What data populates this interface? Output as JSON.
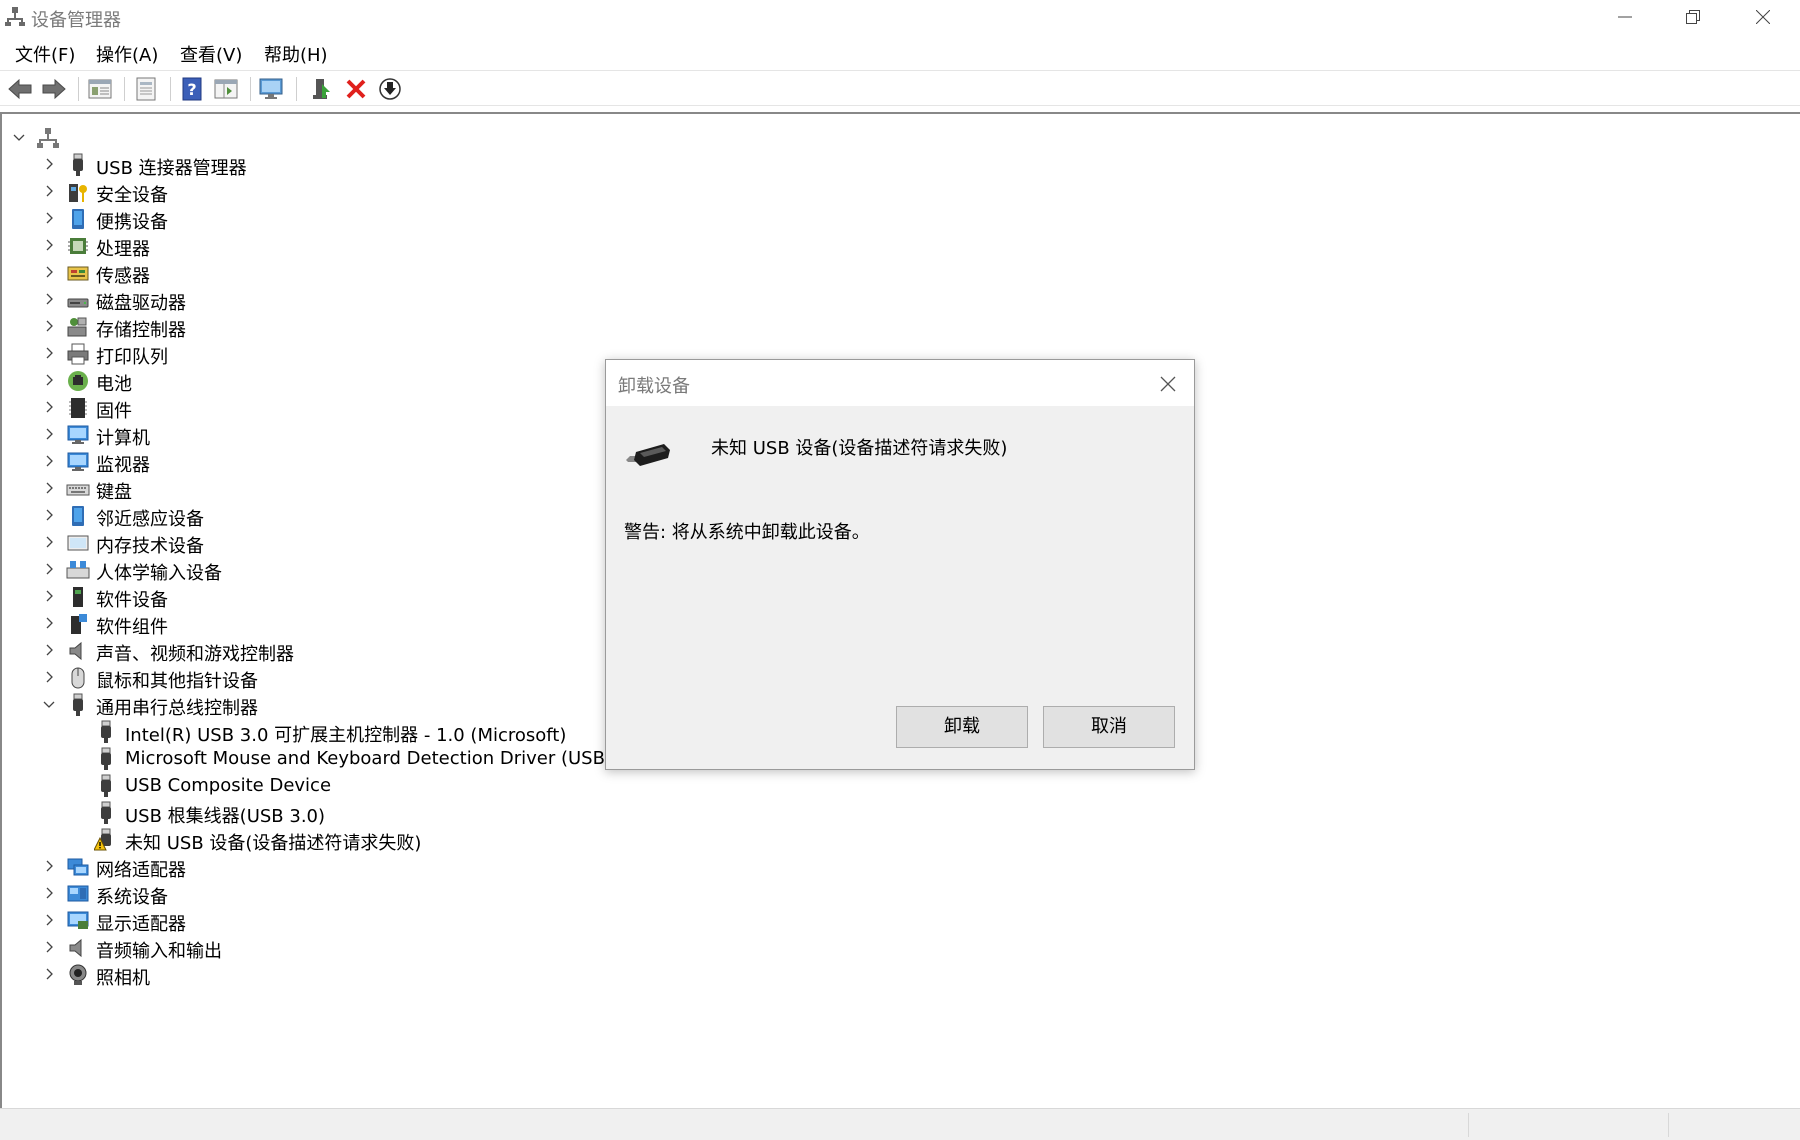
{
  "window": {
    "title": "设备管理器"
  },
  "menu": [
    {
      "label": "文件(F)"
    },
    {
      "label": "操作(A)"
    },
    {
      "label": "查看(V)"
    },
    {
      "label": "帮助(H)"
    }
  ],
  "toolbar": {
    "icons": [
      "back-icon",
      "forward-icon",
      "show-hide-tree-icon",
      "properties-icon",
      "help-icon",
      "view-icon",
      "scan-hardware-icon",
      "update-driver-icon",
      "uninstall-icon",
      "disable-icon"
    ]
  },
  "tree": {
    "root_icon": "computer-root-icon",
    "categories": [
      {
        "label": "USB 连接器管理器",
        "icon": "usb-plug-icon",
        "expanded": false
      },
      {
        "label": "安全设备",
        "icon": "security-key-icon",
        "expanded": false
      },
      {
        "label": "便携设备",
        "icon": "portable-device-icon",
        "expanded": false
      },
      {
        "label": "处理器",
        "icon": "processor-icon",
        "expanded": false
      },
      {
        "label": "传感器",
        "icon": "sensor-icon",
        "expanded": false
      },
      {
        "label": "磁盘驱动器",
        "icon": "disk-drive-icon",
        "expanded": false
      },
      {
        "label": "存储控制器",
        "icon": "storage-controller-icon",
        "expanded": false
      },
      {
        "label": "打印队列",
        "icon": "printer-icon",
        "expanded": false
      },
      {
        "label": "电池",
        "icon": "battery-icon",
        "expanded": false
      },
      {
        "label": "固件",
        "icon": "firmware-icon",
        "expanded": false
      },
      {
        "label": "计算机",
        "icon": "computer-icon",
        "expanded": false
      },
      {
        "label": "监视器",
        "icon": "monitor-icon",
        "expanded": false
      },
      {
        "label": "键盘",
        "icon": "keyboard-icon",
        "expanded": false
      },
      {
        "label": "邻近感应设备",
        "icon": "proximity-device-icon",
        "expanded": false
      },
      {
        "label": "内存技术设备",
        "icon": "memory-device-icon",
        "expanded": false
      },
      {
        "label": "人体学输入设备",
        "icon": "hid-icon",
        "expanded": false
      },
      {
        "label": "软件设备",
        "icon": "software-device-icon",
        "expanded": false
      },
      {
        "label": "软件组件",
        "icon": "software-component-icon",
        "expanded": false
      },
      {
        "label": "声音、视频和游戏控制器",
        "icon": "sound-icon",
        "expanded": false
      },
      {
        "label": "鼠标和其他指针设备",
        "icon": "mouse-icon",
        "expanded": false
      },
      {
        "label": "通用串行总线控制器",
        "icon": "usb-controller-icon",
        "expanded": true,
        "children": [
          {
            "label": "Intel(R) USB 3.0 可扩展主机控制器 - 1.0 (Microsoft)",
            "icon": "usb-plug-icon"
          },
          {
            "label": "Microsoft Mouse and Keyboard Detection Driver (USB)",
            "icon": "usb-plug-icon"
          },
          {
            "label": "USB Composite Device",
            "icon": "usb-plug-icon"
          },
          {
            "label": "USB 根集线器(USB 3.0)",
            "icon": "usb-plug-icon"
          },
          {
            "label": "未知 USB 设备(设备描述符请求失败)",
            "icon": "warning-icon"
          }
        ]
      },
      {
        "label": "网络适配器",
        "icon": "network-adapter-icon",
        "expanded": false
      },
      {
        "label": "系统设备",
        "icon": "system-device-icon",
        "expanded": false
      },
      {
        "label": "显示适配器",
        "icon": "display-adapter-icon",
        "expanded": false
      },
      {
        "label": "音频输入和输出",
        "icon": "audio-io-icon",
        "expanded": false
      },
      {
        "label": "照相机",
        "icon": "camera-icon",
        "expanded": false
      }
    ]
  },
  "dialog": {
    "title": "卸载设备",
    "device_name": "未知 USB 设备(设备描述符请求失败)",
    "warning": "警告: 将从系统中卸载此设备。",
    "uninstall_label": "卸载",
    "cancel_label": "取消"
  }
}
